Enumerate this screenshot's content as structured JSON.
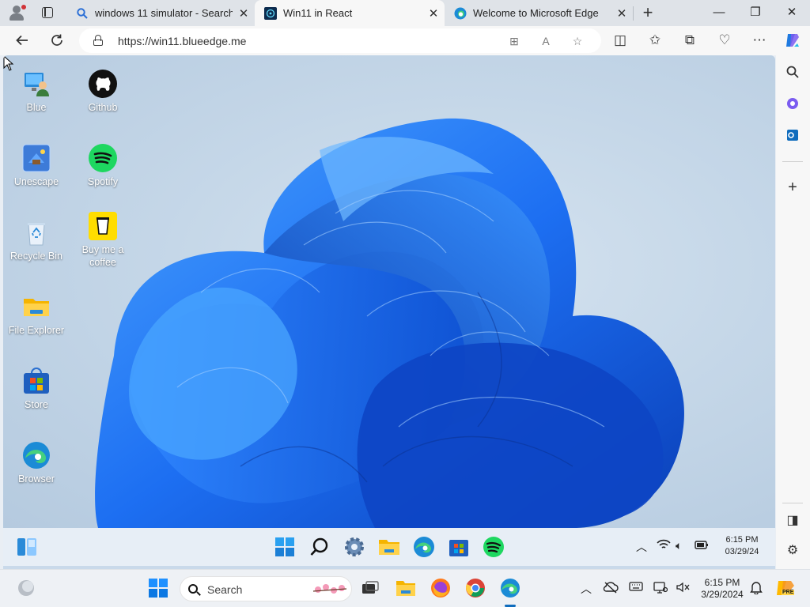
{
  "browser": {
    "tabs": [
      {
        "title": "windows 11 simulator - Search",
        "active": false,
        "favicon": "search-icon"
      },
      {
        "title": "Win11 in React",
        "active": true,
        "favicon": "win11-react-icon"
      },
      {
        "title": "Welcome to Microsoft Edge",
        "active": false,
        "favicon": "edge-icon"
      }
    ],
    "address": {
      "url": "https://win11.blueedge.me"
    }
  },
  "desktop": {
    "icons": [
      {
        "label": "Blue",
        "icon": "user-pc-icon"
      },
      {
        "label": "Github",
        "icon": "github-icon"
      },
      {
        "label": "Unescape",
        "icon": "unescape-icon"
      },
      {
        "label": "Spotify",
        "icon": "spotify-icon"
      },
      {
        "label": "Recycle Bin",
        "icon": "recycle-bin-icon"
      },
      {
        "label": "Buy me a coffee",
        "icon": "coffee-icon"
      },
      {
        "label": "File Explorer",
        "icon": "folder-icon"
      },
      {
        "label": "Store",
        "icon": "store-icon"
      },
      {
        "label": "Browser",
        "icon": "edge-icon"
      }
    ],
    "taskbar": {
      "apps": [
        "widgets-icon",
        "start-icon",
        "search-icon",
        "settings-icon",
        "file-explorer-icon",
        "edge-icon",
        "store-icon",
        "spotify-icon"
      ],
      "clock": {
        "time": "6:15 PM",
        "date": "03/29/24"
      }
    }
  },
  "os_taskbar": {
    "search_placeholder": "Search",
    "apps": [
      "start-icon",
      "search-icon",
      "task-view-icon",
      "file-explorer-icon",
      "firefox-icon",
      "chrome-icon",
      "edge-icon"
    ],
    "clock": {
      "time": "6:15 PM",
      "date": "3/29/2024"
    },
    "copilot_badge": "PRE"
  },
  "colors": {
    "accent": "#0f6cbd",
    "wallpaper_blue": "#1d6ff2",
    "spotify": "#1ed760",
    "coffee": "#ffdd00"
  }
}
